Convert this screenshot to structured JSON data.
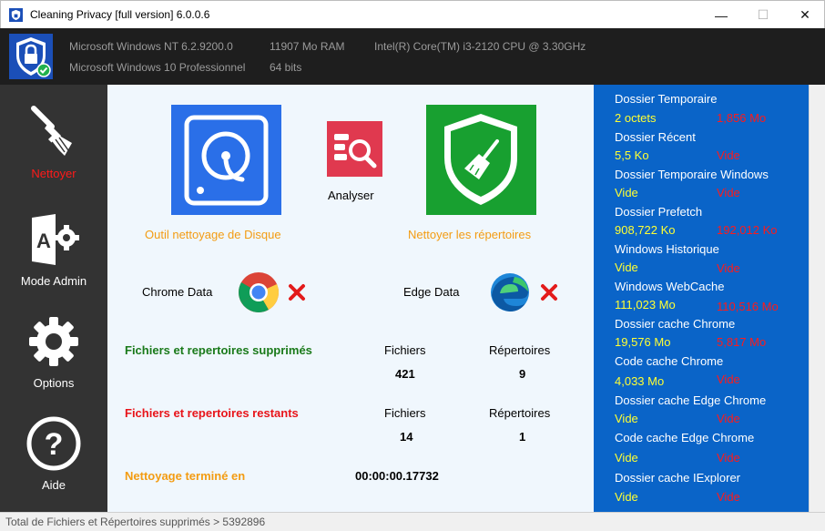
{
  "window": {
    "title": "Cleaning Privacy [full version] 6.0.0.6",
    "min_glyph": "—",
    "max_glyph": "☐",
    "close_glyph": "✕"
  },
  "system": {
    "os_nt": "Microsoft Windows NT 6.2.9200.0",
    "os_name": "Microsoft Windows 10 Professionnel",
    "ram": "11907 Mo RAM",
    "arch": "64 bits",
    "cpu": "Intel(R) Core(TM) i3-2120 CPU @ 3.30GHz"
  },
  "sidebar": {
    "items": [
      {
        "label": "Nettoyer",
        "icon": "broom-icon",
        "active": true
      },
      {
        "label": "Mode Admin",
        "icon": "admin-gear-icon"
      },
      {
        "label": "Options",
        "icon": "gear-icon"
      },
      {
        "label": "Aide",
        "icon": "help-icon"
      }
    ]
  },
  "main": {
    "disk_tool_label": "Outil nettoyage de Disque",
    "analyze_label": "Analyser",
    "clean_dirs_label": "Nettoyer les répertoires",
    "chrome_label": "Chrome Data",
    "edge_label": "Edge Data",
    "deleted_heading": "Fichiers et repertoires supprimés",
    "remaining_heading": "Fichiers et repertoires restants",
    "files_header": "Fichiers",
    "dirs_header": "Répertoires",
    "deleted_files": "421",
    "deleted_dirs": "9",
    "remaining_files": "14",
    "remaining_dirs": "1",
    "finished_label": "Nettoyage terminé en",
    "finished_time": "00:00:00.17732"
  },
  "right_panel": {
    "entries": [
      {
        "title": "Dossier Temporaire",
        "v1": "2 octets",
        "v2": "1,856 Mo"
      },
      {
        "title": "Dossier Récent",
        "v1": "5,5 Ko",
        "v2": "Vide"
      },
      {
        "title": "Dossier Temporaire Windows",
        "v1": "Vide",
        "v2": "Vide"
      },
      {
        "title": "Dossier Prefetch",
        "v1": "908,722 Ko",
        "v2": "192,012 Ko"
      },
      {
        "title": "Windows Historique",
        "v1": "Vide",
        "v2": "Vide"
      },
      {
        "title": "Windows WebCache",
        "v1": "111,023 Mo",
        "v2": "110,516 Mo"
      },
      {
        "title": "Dossier cache Chrome",
        "v1": "19,576 Mo",
        "v2": "5,817 Mo"
      },
      {
        "title": "Code cache Chrome",
        "v1": "4,033 Mo",
        "v2": "Vide"
      },
      {
        "title": "Dossier cache Edge Chrome",
        "v1": "Vide",
        "v2": "Vide"
      },
      {
        "title": "Code cache Edge Chrome",
        "v1": "Vide",
        "v2": "Vide"
      },
      {
        "title": "Dossier cache IExplorer",
        "v1": "Vide",
        "v2": "Vide"
      }
    ]
  },
  "status": {
    "text": "Total de Fichiers et Répertoires supprimés > 5392896"
  },
  "colors": {
    "accent_blue": "#2a6fe8",
    "accent_green": "#18a030",
    "accent_red": "#e0394f",
    "panel_blue": "#0a64c8"
  }
}
